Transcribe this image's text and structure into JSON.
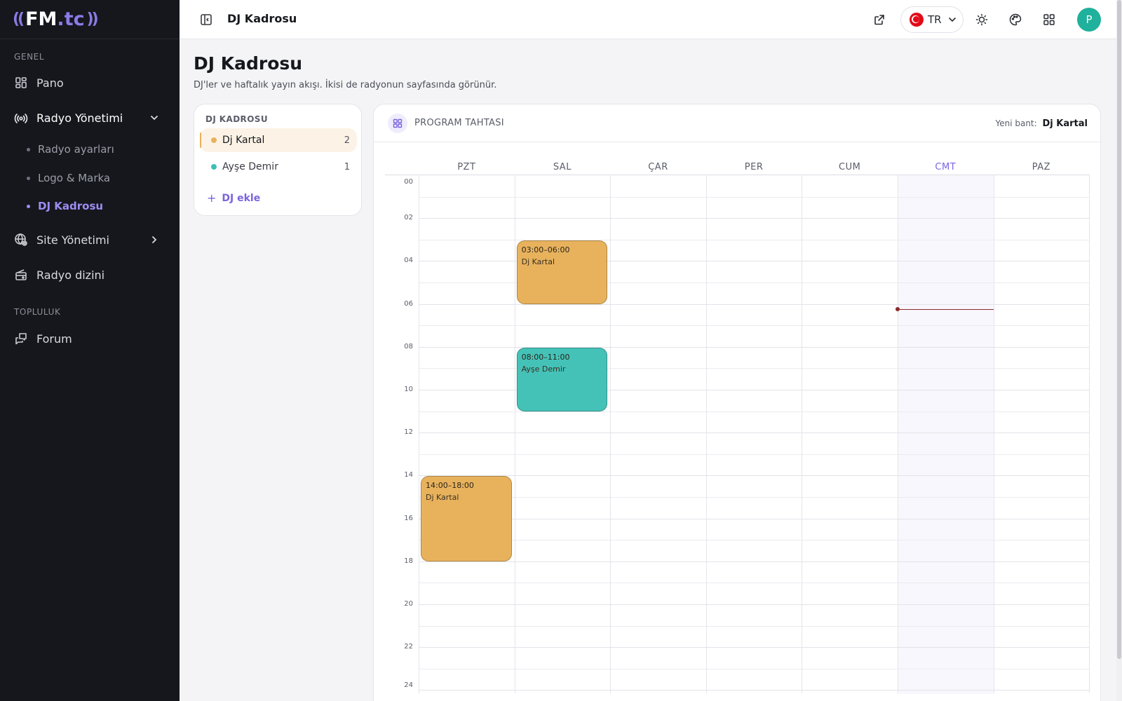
{
  "sidebar": {
    "logo": {
      "left_waves": "((",
      "fm": "FM",
      "dot": ".",
      "tc": "tc",
      "right_waves": "))"
    },
    "sections": [
      {
        "label": "GENEL"
      },
      {
        "label": "TOPLULUK"
      }
    ],
    "items": {
      "pano": "Pano",
      "radyo_yonetimi": "Radyo Yönetimi",
      "radyo_ayarlari": "Radyo ayarları",
      "logo_marka": "Logo & Marka",
      "dj_kadrosu": "DJ Kadrosu",
      "site_yonetimi": "Site Yönetimi",
      "radyo_dizini": "Radyo dizini",
      "forum": "Forum"
    },
    "icons": {
      "pano": "dashboard-icon",
      "radyo_yonetimi": "broadcast-icon",
      "site_yonetimi": "globe-icon",
      "radyo_dizini": "radio-icon",
      "forum": "forum-icon"
    }
  },
  "topbar": {
    "title": "DJ Kadrosu",
    "lang": "TR",
    "avatar_initial": "P",
    "icons": [
      "sidebar-toggle-icon",
      "external-link-icon",
      "sun-icon",
      "palette-icon",
      "apps-grid-icon"
    ]
  },
  "page": {
    "title": "DJ Kadrosu",
    "subtitle": "DJ'ler ve haftalık yayın akışı. İkisi de radyonun sayfasında görünür."
  },
  "dj_list": {
    "title": "DJ KADROSU",
    "items": [
      {
        "name": "Dj Kartal",
        "count": "2",
        "color": "#e8b25d",
        "selected": true
      },
      {
        "name": "Ayşe Demir",
        "count": "1",
        "color": "#3fbfb4",
        "selected": false
      }
    ],
    "add_label": "DJ ekle"
  },
  "schedule": {
    "title": "PROGRAM TAHTASI",
    "new_band_label": "Yeni bant:",
    "new_band_value": "Dj Kartal",
    "days": [
      "PZT",
      "SAL",
      "ÇAR",
      "PER",
      "CUM",
      "CMT",
      "PAZ"
    ],
    "today_index": 5,
    "hour_labels": [
      "00",
      "02",
      "04",
      "06",
      "08",
      "10",
      "12",
      "14",
      "16",
      "18",
      "20",
      "22",
      "24"
    ],
    "now_hour": 6.25,
    "events": [
      {
        "day": 1,
        "start": 3,
        "end": 6,
        "time": "03:00–06:00",
        "dj": "Dj Kartal",
        "color": "#e8b25d"
      },
      {
        "day": 1,
        "start": 8,
        "end": 11,
        "time": "08:00–11:00",
        "dj": "Ayşe Demir",
        "color": "#45c2b8"
      },
      {
        "day": 0,
        "start": 14,
        "end": 18,
        "time": "14:00–18:00",
        "dj": "Dj Kartal",
        "color": "#e8b25d"
      }
    ]
  }
}
